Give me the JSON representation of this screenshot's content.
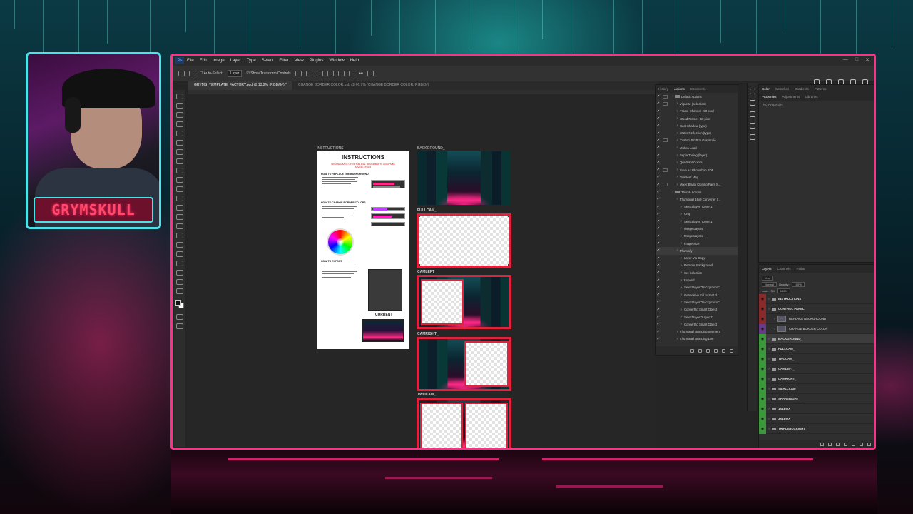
{
  "overlay": {
    "nameplate": "GRYMSKULL"
  },
  "photoshop": {
    "menu": [
      "File",
      "Edit",
      "Image",
      "Layer",
      "Type",
      "Select",
      "Filter",
      "View",
      "Plugins",
      "Window",
      "Help"
    ],
    "options": {
      "auto_select": "Auto-Select:",
      "auto_select_target": "Layer",
      "show_transform": "Show Transform Controls"
    },
    "tabs": [
      "GRYMS_TEMPLATE_FACTORY.psd @ 13.2% (RGB/8#) *",
      "CHANGE BORDER COLOR.psb @ 66.7% (CHANGE BORDER COLOR, RGB/8#)"
    ],
    "canvas": {
      "instructions_label": "INSTRUCTIONS",
      "background_label": "BACKGROUND_",
      "fullcam_label": "FULLCAM_",
      "camleft_label": "CAMLEFT_",
      "camright_label": "CAMRIGHT_",
      "twocam_label": "TWOCAM_",
      "instructions_title": "INSTRUCTIONS",
      "instructions_warning": "CREATE A BACK UP OF THIS FILE. REMEMBER TO ALWAYS BE SAVING CTRL S",
      "section_replace": "HOW TO REPLACE THE BACKGROUND",
      "section_border": "HOW TO CHANGE BORDER COLORS",
      "section_export": "HOW TO EXPORT",
      "current_label": "CURRENT"
    },
    "actions_panel": {
      "tabs": [
        "History",
        "Actions",
        "Comments"
      ],
      "items": [
        {
          "label": "Default Actions",
          "level": 0,
          "folder": true,
          "check": "✔",
          "dialog": true
        },
        {
          "label": "Vignette (selection)",
          "level": 1,
          "check": "✔",
          "dialog": true
        },
        {
          "label": "Frame Channel - 50 pixel",
          "level": 1,
          "check": "✔",
          "dialog": false
        },
        {
          "label": "Wood Frame - 50 pixel",
          "level": 1,
          "check": "✔",
          "dialog": false
        },
        {
          "label": "Cast Shadow (type)",
          "level": 1,
          "check": "✔",
          "dialog": false
        },
        {
          "label": "Water Reflection (type)",
          "level": 1,
          "check": "✔",
          "dialog": false
        },
        {
          "label": "Custom RGB to Grayscale",
          "level": 1,
          "check": "✔",
          "dialog": true
        },
        {
          "label": "Molten Lead",
          "level": 1,
          "check": "✔",
          "dialog": false
        },
        {
          "label": "Sepia Toning (layer)",
          "level": 1,
          "check": "✔",
          "dialog": false
        },
        {
          "label": "Quadrant Colors",
          "level": 1,
          "check": "✔",
          "dialog": false
        },
        {
          "label": "Save As Photoshop PDF",
          "level": 1,
          "check": "✔",
          "dialog": true
        },
        {
          "label": "Gradient Map",
          "level": 1,
          "check": "✔",
          "dialog": false
        },
        {
          "label": "Mixer Brush Cloning Paint S...",
          "level": 1,
          "check": "✔",
          "dialog": true
        },
        {
          "label": "Thumb Actions",
          "level": 0,
          "folder": true,
          "check": "✔",
          "dialog": false
        },
        {
          "label": "Thumbnail 16x9 Converter (...",
          "level": 1,
          "check": "✔",
          "dialog": false
        },
        {
          "label": "Select layer \"Layer 1\"",
          "level": 2,
          "check": "✔",
          "dialog": false
        },
        {
          "label": "Crop",
          "level": 2,
          "check": "✔",
          "dialog": false
        },
        {
          "label": "Select layer \"Layer 1\"",
          "level": 2,
          "check": "✔",
          "dialog": false
        },
        {
          "label": "Merge Layers",
          "level": 2,
          "check": "✔",
          "dialog": false
        },
        {
          "label": "Merge Layers",
          "level": 2,
          "check": "✔",
          "dialog": false
        },
        {
          "label": "Image Size",
          "level": 2,
          "check": "✔",
          "dialog": false
        },
        {
          "label": "Thumbify",
          "level": 1,
          "check": "✔",
          "dialog": false,
          "selected": true
        },
        {
          "label": "Layer Via Copy",
          "level": 2,
          "check": "✔",
          "dialog": false
        },
        {
          "label": "Remove Background",
          "level": 2,
          "check": "✔",
          "dialog": false
        },
        {
          "label": "Set Selection",
          "level": 2,
          "check": "✔",
          "dialog": false
        },
        {
          "label": "Expand",
          "level": 2,
          "check": "✔",
          "dialog": false
        },
        {
          "label": "Select layer \"Background\"",
          "level": 2,
          "check": "✔",
          "dialog": false
        },
        {
          "label": "Generative Fill current d...",
          "level": 2,
          "check": "✔",
          "dialog": false
        },
        {
          "label": "Select layer \"Background\"",
          "level": 2,
          "check": "✔",
          "dialog": false
        },
        {
          "label": "Convert to Smart Object",
          "level": 2,
          "check": "✔",
          "dialog": false
        },
        {
          "label": "Select layer \"Layer 1\"",
          "level": 2,
          "check": "✔",
          "dialog": false
        },
        {
          "label": "Convert to Smart Object",
          "level": 2,
          "check": "✔",
          "dialog": false
        },
        {
          "label": "Thumbnail Branding Segment",
          "level": 1,
          "check": "✔",
          "dialog": false
        },
        {
          "label": "Thumbnail Branding Live",
          "level": 1,
          "check": "✔",
          "dialog": false
        }
      ]
    },
    "color_panel": {
      "tabs": [
        "Color",
        "Swatches",
        "Gradients",
        "Patterns"
      ],
      "props_tabs": [
        "Properties",
        "Adjustments",
        "Libraries"
      ],
      "no_properties": "No Properties"
    },
    "layers_panel": {
      "tabs": [
        "Layers",
        "Channels",
        "Paths"
      ],
      "kind": "Kind",
      "blend": "Normal",
      "opacity_label": "Opacity:",
      "opacity": "100%",
      "lock_label": "Lock:",
      "fill_label": "Fill:",
      "fill": "100%",
      "layers": [
        {
          "name": "INSTRUCTIONS",
          "color": "red",
          "bold": true,
          "indent": 0
        },
        {
          "name": "CONTROL PANEL",
          "color": "red",
          "bold": true,
          "indent": 0
        },
        {
          "name": "REPLACE BACKGROUND",
          "color": "red",
          "bold": false,
          "indent": 1,
          "thumb": true
        },
        {
          "name": "CHANGE BORDER COLOR",
          "color": "violet",
          "bold": false,
          "indent": 1,
          "thumb": true
        },
        {
          "name": "BACKGROUND_",
          "color": "green",
          "bold": true,
          "indent": 0,
          "selected": true
        },
        {
          "name": "FULLCAM_",
          "color": "green",
          "bold": true,
          "indent": 0
        },
        {
          "name": "TWOCAM_",
          "color": "green",
          "bold": true,
          "indent": 0
        },
        {
          "name": "CAMLEFT_",
          "color": "green",
          "bold": true,
          "indent": 0
        },
        {
          "name": "CAMRIGHT_",
          "color": "green",
          "bold": true,
          "indent": 0
        },
        {
          "name": "SMALLCAM_",
          "color": "green",
          "bold": true,
          "indent": 0
        },
        {
          "name": "SHARERIGHT_",
          "color": "green",
          "bold": true,
          "indent": 0
        },
        {
          "name": "1X1BOX_",
          "color": "green",
          "bold": true,
          "indent": 0
        },
        {
          "name": "3X1BOX_",
          "color": "green",
          "bold": true,
          "indent": 0
        },
        {
          "name": "TRIPLEBOXRIGHT_",
          "color": "green",
          "bold": true,
          "indent": 0
        }
      ]
    }
  }
}
